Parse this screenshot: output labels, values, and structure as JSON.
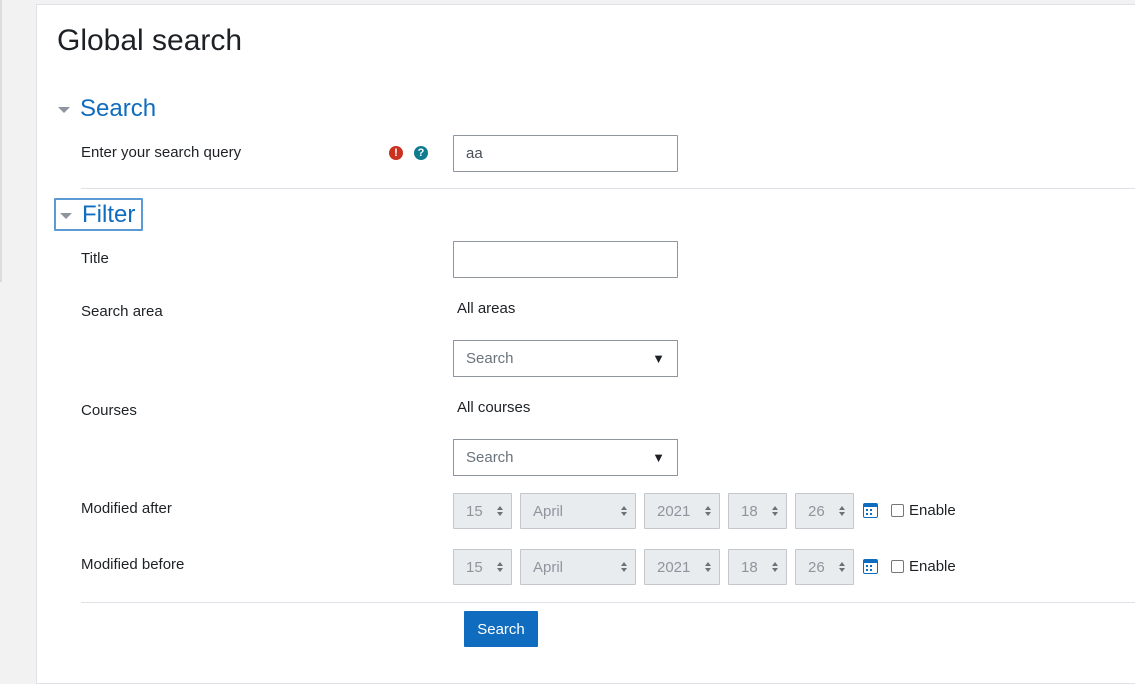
{
  "page": {
    "title": "Global search"
  },
  "search_section": {
    "heading": "Search",
    "query_label": "Enter your search query",
    "query_value": "aa",
    "required_icon": "exclamation-circle-icon",
    "help_icon": "question-circle-icon"
  },
  "filter_section": {
    "heading": "Filter",
    "title_label": "Title",
    "title_value": "",
    "search_area": {
      "label": "Search area",
      "selected": "All areas",
      "placeholder": "Search"
    },
    "courses": {
      "label": "Courses",
      "selected": "All courses",
      "placeholder": "Search"
    },
    "modified_after": {
      "label": "Modified after",
      "day": "15",
      "month": "April",
      "year": "2021",
      "hour": "18",
      "minute": "26",
      "enable_label": "Enable",
      "enabled": false
    },
    "modified_before": {
      "label": "Modified before",
      "day": "15",
      "month": "April",
      "year": "2021",
      "hour": "18",
      "minute": "26",
      "enable_label": "Enable",
      "enabled": false
    }
  },
  "submit": {
    "label": "Search"
  },
  "colors": {
    "brand": "#0f6cbf",
    "required": "#ca3120",
    "help": "#0f7b8f"
  }
}
